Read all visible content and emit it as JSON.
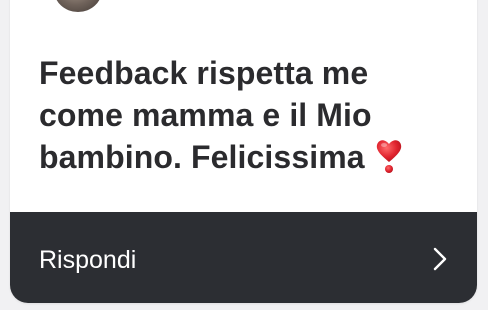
{
  "message": {
    "text": "Feedback rispetta me come mamma e il Mio bambino. Felicissima",
    "emoji_icon": "red-heart-exclamation-icon"
  },
  "reply": {
    "label": "Rispondi",
    "icon": "chevron-right-icon"
  },
  "colors": {
    "card_background": "#ffffff",
    "page_background": "#f1f1f3",
    "text": "#2b2b2e",
    "reply_bar": "#2c2e33",
    "reply_text": "#ffffff",
    "heart": "#e0232e"
  }
}
